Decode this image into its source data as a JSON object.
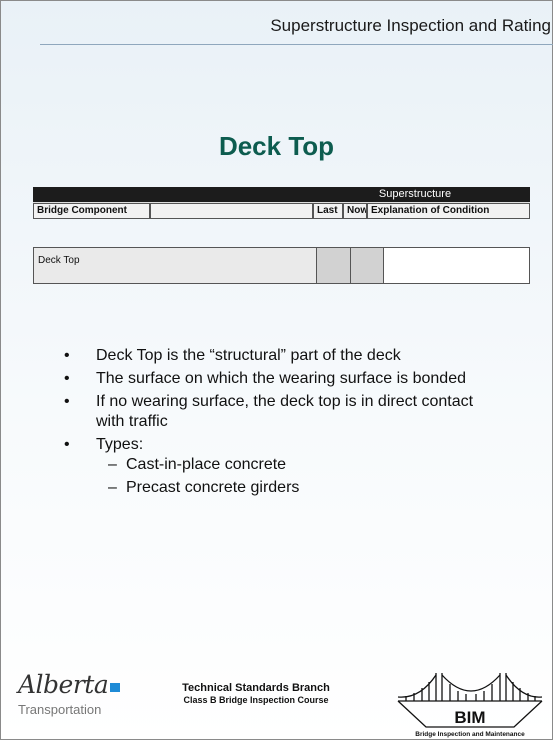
{
  "header": {
    "title": "Superstructure Inspection and Rating"
  },
  "slide": {
    "title": "Deck Top"
  },
  "table": {
    "group_header": "Superstructure",
    "columns": [
      "Bridge Component",
      "",
      "Last",
      "Now",
      "Explanation of Condition"
    ],
    "row_label": "Deck Top"
  },
  "bullets": [
    "Deck Top is the “structural” part of the deck",
    "The surface on which the wearing surface is bonded",
    "If no wearing surface, the deck top is in direct contact with traffic",
    "Types:"
  ],
  "sub_bullets": [
    "Cast-in-place concrete",
    "Precast concrete girders"
  ],
  "footer": {
    "logo_alberta": "Alberta",
    "logo_transportation": "Transportation",
    "center_line1": "Technical Standards Branch",
    "center_line2": "Class B Bridge Inspection Course",
    "bim_text": "BIM",
    "bim_caption": "Bridge Inspection and Maintenance"
  },
  "colors": {
    "title": "#0d5c4f",
    "table_header": "#1c1c1c",
    "alberta_mark": "#1f8bd6"
  }
}
